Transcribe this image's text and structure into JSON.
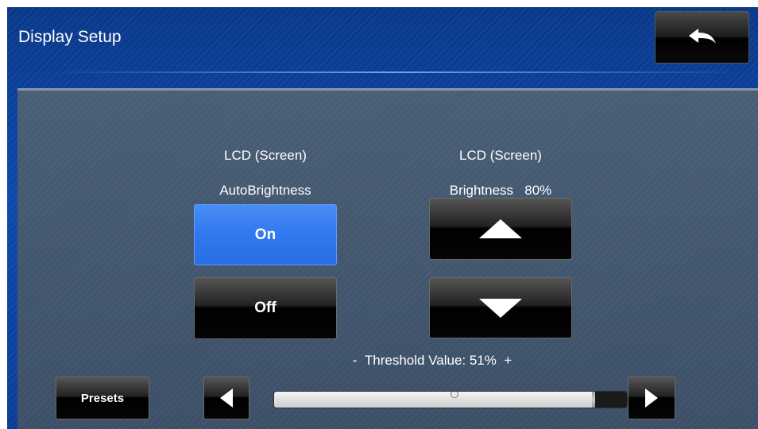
{
  "header": {
    "title": "Display Setup",
    "back_icon": "back-arrow-icon"
  },
  "auto_brightness": {
    "heading": "LCD (Screen)",
    "subheading": "AutoBrightness",
    "on_label": "On",
    "off_label": "Off",
    "selected": "On"
  },
  "brightness": {
    "heading": "LCD (Screen)",
    "label": "Brightness",
    "value": "80%",
    "up_icon": "triangle-up-icon",
    "down_icon": "triangle-down-icon"
  },
  "threshold": {
    "minus": "-",
    "label": "Threshold Value: 51%",
    "plus": "+",
    "value_fraction": 0.51,
    "left_icon": "triangle-left-icon",
    "right_icon": "triangle-right-icon"
  },
  "footer": {
    "presets_label": "Presets"
  },
  "colors": {
    "header_blue": "#0d4ab0",
    "panel": "#44586f",
    "selected_blue": "#2f78ee",
    "button_black": "#000000"
  }
}
